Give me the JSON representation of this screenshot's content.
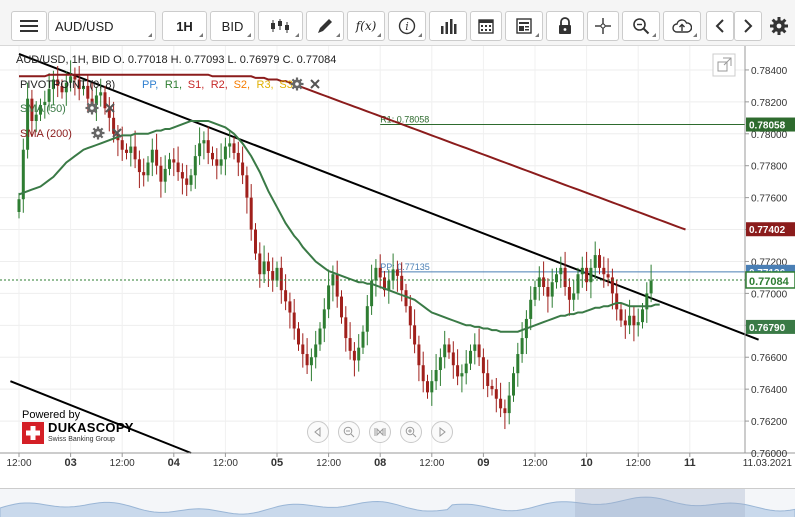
{
  "toolbar": {
    "symbol": "AUD/USD",
    "timeframe": "1H",
    "side": "BID",
    "fx_label": "f(x)"
  },
  "legend": {
    "ohlc": "AUD/USD, 1H, BID   O. 0.77018 H. 0.77093 L. 0.76979 C. 0.77084",
    "pivot_title": "PIVOTPOINT (0, 8)",
    "pivot_items": [
      {
        "label": "PP,",
        "color": "#2f7fd0"
      },
      {
        "label": "R1,",
        "color": "#2e7d32"
      },
      {
        "label": "S1,",
        "color": "#c62828"
      },
      {
        "label": "R2,",
        "color": "#c62828"
      },
      {
        "label": "S2,",
        "color": "#f57c00"
      },
      {
        "label": "R3,",
        "color": "#e0b000"
      },
      {
        "label": "S3",
        "color": "#e0b000"
      }
    ],
    "sma50": "SMA (50)",
    "sma200": "SMA (200)"
  },
  "branding": {
    "powered_by": "Powered by",
    "name": "DUKASCOPY",
    "sub": "Swiss Banking Group"
  },
  "colors": {
    "bull": "#2e7d32",
    "bear": "#a0201c",
    "sma50": "#3a7a46",
    "sma200": "#8b1c1c",
    "trend": "#000000",
    "r1": "#2e6b2e",
    "pp": "#4a7fb5",
    "current": "#2e7d32",
    "sma200_tag": "#8b1c1c"
  },
  "chart_data": {
    "type": "candlestick",
    "symbol": "AUD/USD",
    "interval": "1H",
    "price_type": "BID",
    "ylim": [
      0.76,
      0.7855
    ],
    "y_ticks": [
      "0.78400",
      "0.78200",
      "0.78000",
      "0.77800",
      "0.77600",
      "0.77400",
      "0.77200",
      "0.77000",
      "0.76800",
      "0.76600",
      "0.76400",
      "0.76200",
      "0.76000"
    ],
    "x_ticks": [
      {
        "label": "12:00",
        "bar": 0
      },
      {
        "label": "03",
        "bar": 12
      },
      {
        "label": "12:00",
        "bar": 24
      },
      {
        "label": "04",
        "bar": 36
      },
      {
        "label": "12:00",
        "bar": 48
      },
      {
        "label": "05",
        "bar": 60
      },
      {
        "label": "12:00",
        "bar": 72
      },
      {
        "label": "08",
        "bar": 84
      },
      {
        "label": "12:00",
        "bar": 96
      },
      {
        "label": "09",
        "bar": 108
      },
      {
        "label": "12:00",
        "bar": 120
      },
      {
        "label": "10",
        "bar": 132
      },
      {
        "label": "12:00",
        "bar": 144
      },
      {
        "label": "11",
        "bar": 156
      },
      {
        "label": "11.03.2021",
        "bar": 168
      }
    ],
    "closes": [
      0.7759,
      0.779,
      0.7822,
      0.7808,
      0.7812,
      0.7818,
      0.782,
      0.7828,
      0.7834,
      0.783,
      0.7826,
      0.7832,
      0.7836,
      0.7834,
      0.7828,
      0.783,
      0.7822,
      0.7818,
      0.7824,
      0.7826,
      0.7816,
      0.781,
      0.78,
      0.7796,
      0.779,
      0.7788,
      0.7792,
      0.7784,
      0.7776,
      0.7774,
      0.7782,
      0.779,
      0.778,
      0.777,
      0.7778,
      0.7784,
      0.7782,
      0.7776,
      0.7772,
      0.7768,
      0.7774,
      0.7786,
      0.7794,
      0.7796,
      0.7788,
      0.7784,
      0.778,
      0.7784,
      0.7792,
      0.7794,
      0.7788,
      0.7782,
      0.7774,
      0.776,
      0.774,
      0.7725,
      0.7712,
      0.772,
      0.7714,
      0.7708,
      0.7716,
      0.7702,
      0.7695,
      0.7688,
      0.7678,
      0.7668,
      0.7662,
      0.7655,
      0.766,
      0.7668,
      0.7678,
      0.769,
      0.7705,
      0.7712,
      0.7698,
      0.7685,
      0.7672,
      0.7664,
      0.7658,
      0.7666,
      0.7676,
      0.7692,
      0.7708,
      0.7716,
      0.771,
      0.7702,
      0.7708,
      0.7715,
      0.7711,
      0.7702,
      0.7692,
      0.768,
      0.7668,
      0.7655,
      0.7645,
      0.7638,
      0.7645,
      0.7652,
      0.766,
      0.7668,
      0.7663,
      0.7655,
      0.7648,
      0.765,
      0.7656,
      0.7664,
      0.7668,
      0.766,
      0.765,
      0.7642,
      0.764,
      0.7634,
      0.7628,
      0.7625,
      0.7636,
      0.765,
      0.7662,
      0.7672,
      0.7684,
      0.7696,
      0.7704,
      0.771,
      0.7704,
      0.7698,
      0.7707,
      0.7712,
      0.7716,
      0.7704,
      0.7696,
      0.77,
      0.7712,
      0.7716,
      0.7707,
      0.7716,
      0.7724,
      0.7716,
      0.7712,
      0.771,
      0.77,
      0.769,
      0.7683,
      0.768,
      0.7686,
      0.768,
      0.7682,
      0.769,
      0.77,
      0.7708
    ],
    "sma50": [
      0.7762,
      0.7763,
      0.7764,
      0.7765,
      0.7766,
      0.7767,
      0.7769,
      0.7771,
      0.7773,
      0.7776,
      0.7779,
      0.7782,
      0.7784,
      0.7786,
      0.7788,
      0.779,
      0.7791,
      0.7792,
      0.7793,
      0.7794,
      0.7795,
      0.7796,
      0.7797,
      0.7798,
      0.7799,
      0.7799,
      0.7799,
      0.78,
      0.78,
      0.78,
      0.78,
      0.7801,
      0.7802,
      0.7802,
      0.7803,
      0.7803,
      0.7804,
      0.7805,
      0.7806,
      0.7807,
      0.7808,
      0.7808,
      0.7808,
      0.7808,
      0.7808,
      0.7807,
      0.7806,
      0.7805,
      0.7804,
      0.7802,
      0.78,
      0.7797,
      0.7794,
      0.779,
      0.7786,
      0.7781,
      0.7776,
      0.777,
      0.7764,
      0.7759,
      0.7754,
      0.7749,
      0.7744,
      0.774,
      0.7736,
      0.7733,
      0.7729,
      0.7726,
      0.7723,
      0.772,
      0.7718,
      0.7716,
      0.7714,
      0.7713,
      0.7712,
      0.7711,
      0.771,
      0.7709,
      0.7708,
      0.7707,
      0.7707,
      0.7706,
      0.7706,
      0.7705,
      0.7704,
      0.7703,
      0.7702,
      0.7701,
      0.77,
      0.7699,
      0.7698,
      0.7697,
      0.7696,
      0.7694,
      0.7692,
      0.769,
      0.7688,
      0.7687,
      0.7686,
      0.7685,
      0.7684,
      0.7683,
      0.7682,
      0.7681,
      0.768,
      0.768,
      0.7679,
      0.7679,
      0.7678,
      0.7678,
      0.7677,
      0.7677,
      0.7676,
      0.7676,
      0.7676,
      0.7676,
      0.7676,
      0.7677,
      0.7678,
      0.7679,
      0.768,
      0.7681,
      0.7682,
      0.7683,
      0.7684,
      0.7685,
      0.7686,
      0.7686,
      0.7687,
      0.7687,
      0.7688,
      0.7688,
      0.7689,
      0.769,
      0.7691,
      0.7691,
      0.7692,
      0.7692,
      0.7693,
      0.7694,
      0.7694,
      0.7693,
      0.7692,
      0.7692,
      0.7692,
      0.7692,
      0.7692,
      0.7692,
      0.7693,
      0.7693
    ],
    "sma200": [
      0.7836,
      0.7836,
      0.7836,
      0.7836,
      0.7836,
      0.7836,
      0.7836,
      0.7837,
      0.7837,
      0.7837,
      0.7837,
      0.7837,
      0.7837,
      0.7837,
      0.7837,
      0.7837,
      0.7837,
      0.7837,
      0.7837,
      0.7837,
      0.7837,
      0.7837,
      0.7837,
      0.7837,
      0.7837,
      0.7837,
      0.7837,
      0.7837,
      0.7837,
      0.7837,
      0.7837,
      0.7837,
      0.7837,
      0.7837,
      0.7837,
      0.7837,
      0.7837,
      0.7837,
      0.7837,
      0.7837,
      0.7837,
      0.7837,
      0.7837,
      0.7837,
      0.7837,
      0.7836,
      0.7836,
      0.7836,
      0.7836,
      0.7836,
      0.7836,
      0.7836,
      0.7836,
      0.7836,
      0.7836,
      0.7835,
      0.7835,
      0.7835,
      0.7834,
      0.7834,
      0.7834,
      0.7833,
      0.7833,
      0.7832,
      0.7831,
      0.783,
      0.7829,
      0.7828,
      0.7827,
      0.7826,
      0.7825,
      0.7824,
      0.7823,
      0.7822,
      0.7821,
      0.782,
      0.7819,
      0.7818,
      0.7817,
      0.7816,
      0.7815,
      0.7814,
      0.7813,
      0.7812,
      0.7811,
      0.781,
      0.7809,
      0.7808,
      0.7807,
      0.7806,
      0.7805,
      0.7804,
      0.7803,
      0.7802,
      0.7801,
      0.78,
      0.7799,
      0.7798,
      0.7797,
      0.7796,
      0.7795,
      0.7794,
      0.7793,
      0.7792,
      0.7791,
      0.779,
      0.7789,
      0.7788,
      0.7787,
      0.7786,
      0.7785,
      0.7784,
      0.7783,
      0.7782,
      0.7781,
      0.778,
      0.7779,
      0.7778,
      0.7777,
      0.7776,
      0.7775,
      0.7774,
      0.7773,
      0.7772,
      0.7771,
      0.777,
      0.7769,
      0.7768,
      0.7767,
      0.7766,
      0.7765,
      0.7764,
      0.7763,
      0.7762,
      0.7761,
      0.776,
      0.7759,
      0.7758,
      0.7757,
      0.7756,
      0.7755,
      0.7754,
      0.7753,
      0.7752,
      0.7751,
      0.775,
      0.7749,
      0.7748,
      0.7747,
      0.7746,
      0.7745,
      0.7744,
      0.7743,
      0.7742,
      0.7741,
      0.774
    ],
    "levels": [
      {
        "name": "R1",
        "label": "R1: 0.78058",
        "value": 0.78058,
        "tag": "0.78058"
      },
      {
        "name": "PP",
        "label": "PP: 0.77135",
        "value": 0.77135,
        "tag": "0.77136"
      }
    ],
    "price_tags": [
      {
        "name": "sma200",
        "text": "0.77402",
        "value": 0.77402
      },
      {
        "name": "current",
        "text": "0.77084",
        "value": 0.77084
      },
      {
        "name": "sma50",
        "text": "0.76790",
        "value": 0.7679
      }
    ],
    "trendlines": [
      {
        "from": [
          0,
          0.785
        ],
        "to": [
          172,
          0.7671
        ]
      },
      {
        "from": [
          -2,
          0.7645
        ],
        "to": [
          40,
          0.76
        ]
      }
    ]
  }
}
